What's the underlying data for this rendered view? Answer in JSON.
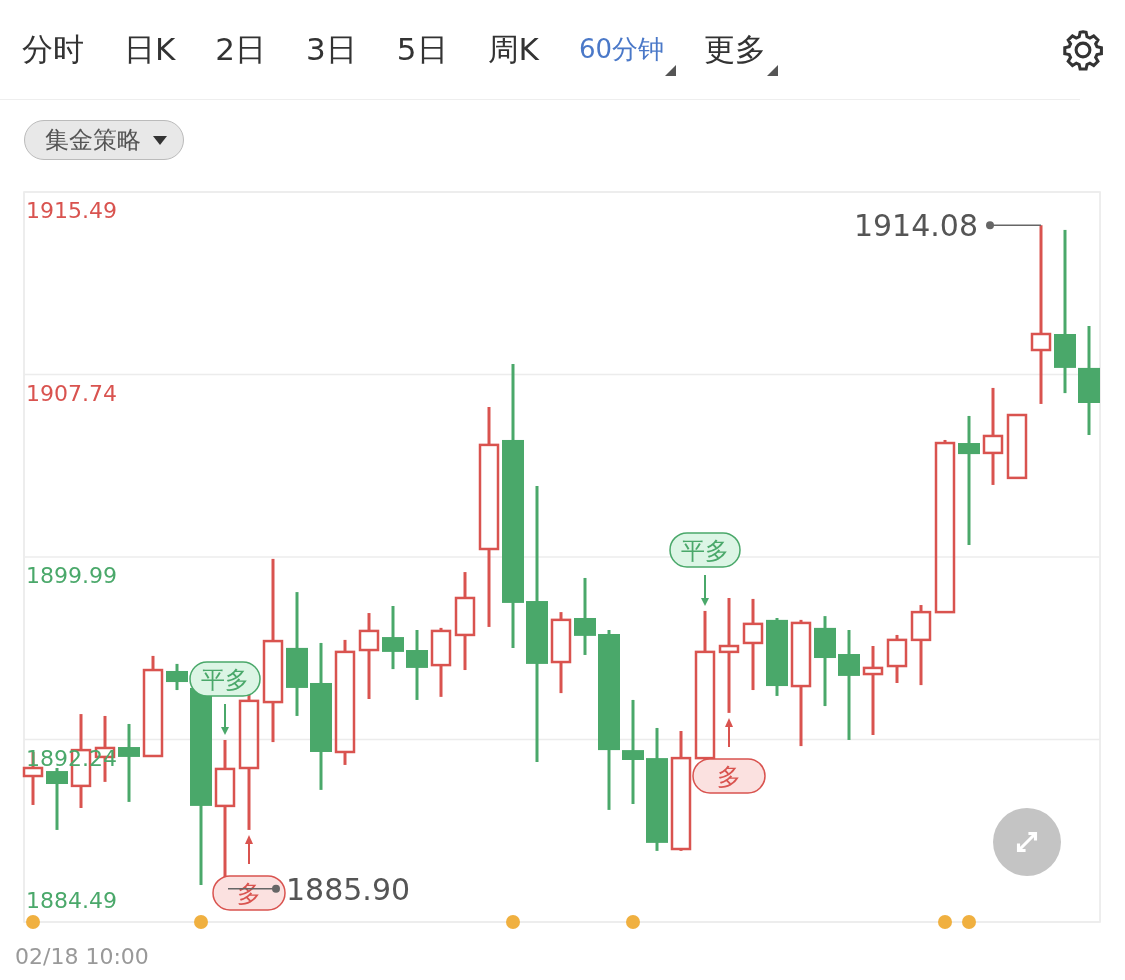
{
  "tabs": [
    {
      "label": "分时",
      "selected": false,
      "dropdown": false
    },
    {
      "label": "日K",
      "selected": false,
      "dropdown": false
    },
    {
      "label": "2日",
      "selected": false,
      "dropdown": false
    },
    {
      "label": "3日",
      "selected": false,
      "dropdown": false
    },
    {
      "label": "5日",
      "selected": false,
      "dropdown": false
    },
    {
      "label": "周K",
      "selected": false,
      "dropdown": false
    },
    {
      "label": "60分钟",
      "selected": true,
      "dropdown": true
    },
    {
      "label": "更多",
      "selected": false,
      "dropdown": true
    }
  ],
  "strategy_dropdown": {
    "label": "集金策略"
  },
  "chart": {
    "y_axis_labels": [
      {
        "label": "1915.49",
        "color": "#d9534f"
      },
      {
        "label": "1907.74",
        "color": "#d9534f"
      },
      {
        "label": "1899.99",
        "color": "#4aa86a"
      },
      {
        "label": "1892.24",
        "color": "#4aa86a"
      },
      {
        "label": "1884.49",
        "color": "#4aa86a"
      }
    ],
    "x_axis_label": "02/18 10:00",
    "signals": [
      {
        "label": "平多",
        "kind": "exit"
      },
      {
        "label": "多",
        "kind": "entry"
      },
      {
        "label": "平多",
        "kind": "exit"
      },
      {
        "label": "多",
        "kind": "entry"
      }
    ],
    "price_labels": [
      {
        "label": "1885.90",
        "kind": "low"
      },
      {
        "label": "1914.08",
        "kind": "high"
      }
    ]
  }
}
